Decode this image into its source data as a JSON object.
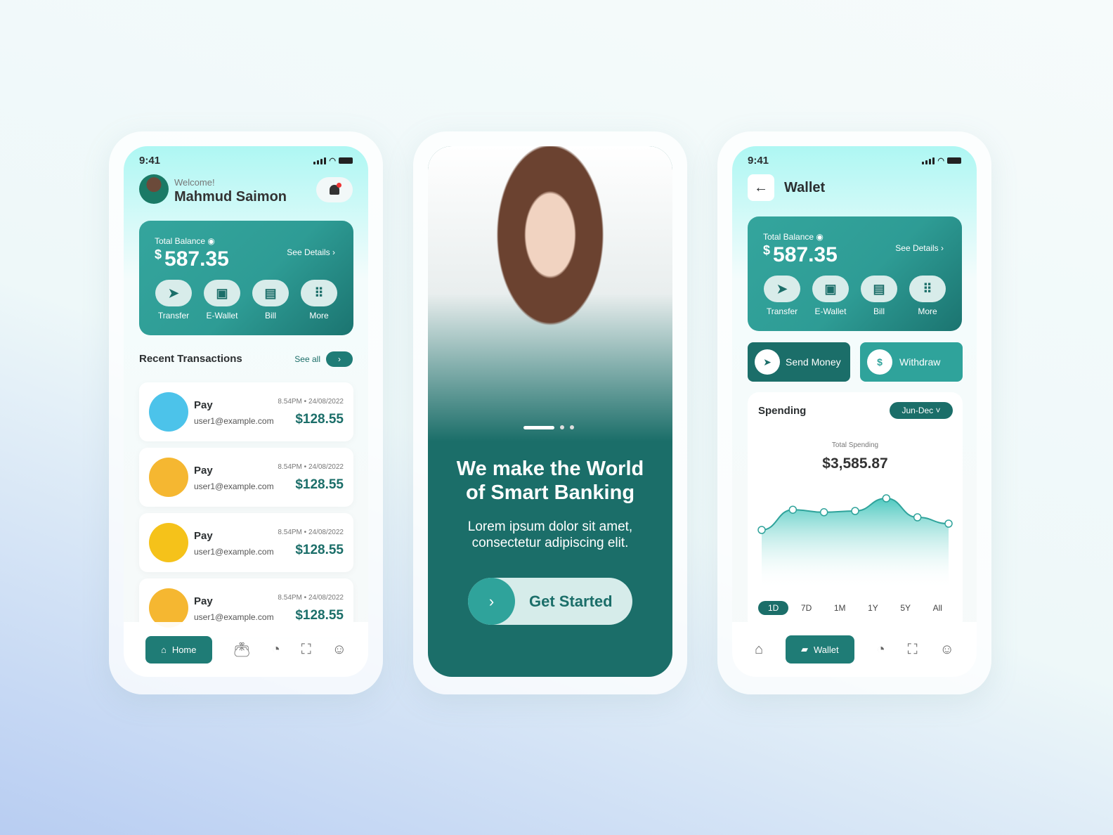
{
  "status": {
    "time": "9:41"
  },
  "home": {
    "welcome": "Welcome!",
    "user_name": "Mahmud Saimon",
    "balance": {
      "label": "Total Balance",
      "currency": "$",
      "amount": "587.35",
      "see_details": "See Details"
    },
    "actions": [
      {
        "label": "Transfer",
        "icon": "send-icon"
      },
      {
        "label": "E-Wallet",
        "icon": "wallet-icon"
      },
      {
        "label": "Bill",
        "icon": "bill-icon"
      },
      {
        "label": "More",
        "icon": "grid-icon"
      }
    ],
    "recent_title": "Recent Transactions",
    "see_all": "See all",
    "transactions": [
      {
        "title": "Pay",
        "email": "user1@example.com",
        "datetime": "8.54PM • 24/08/2022",
        "amount": "$128.55",
        "avatar_color": "#4cc3ea"
      },
      {
        "title": "Pay",
        "email": "user1@example.com",
        "datetime": "8.54PM • 24/08/2022",
        "amount": "$128.55",
        "avatar_color": "#f5b731"
      },
      {
        "title": "Pay",
        "email": "user1@example.com",
        "datetime": "8.54PM • 24/08/2022",
        "amount": "$128.55",
        "avatar_color": "#f5c21a"
      },
      {
        "title": "Pay",
        "email": "user1@example.com",
        "datetime": "8.54PM • 24/08/2022",
        "amount": "$128.55",
        "avatar_color": "#f5b731"
      }
    ],
    "nav": {
      "active": "Home"
    }
  },
  "onboarding": {
    "headline": "We make the World of Smart Banking",
    "body": "Lorem ipsum dolor sit amet, consectetur adipiscing elit.",
    "cta": "Get Started",
    "page_indicator": {
      "current": 1,
      "total": 3
    }
  },
  "wallet": {
    "title": "Wallet",
    "balance": {
      "label": "Total Balance",
      "currency": "$",
      "amount": "587.35",
      "see_details": "See Details"
    },
    "actions": [
      {
        "label": "Transfer"
      },
      {
        "label": "E-Wallet"
      },
      {
        "label": "Bill"
      },
      {
        "label": "More"
      }
    ],
    "send_money": "Send Money",
    "withdraw": "Withdraw",
    "spending": {
      "title": "Spending",
      "period": "Jun-Dec",
      "total_label": "Total Spending",
      "total": "$3,585.87",
      "relative_points": [
        10,
        42,
        38,
        40,
        60,
        30,
        20
      ],
      "ranges": [
        "1D",
        "7D",
        "1M",
        "1Y",
        "5Y",
        "All"
      ],
      "active_range": "1D"
    },
    "nav": {
      "active": "Wallet"
    }
  },
  "colors": {
    "primary": "#1b6e69",
    "accent": "#2fa39b",
    "mint": "#aef7f3"
  }
}
